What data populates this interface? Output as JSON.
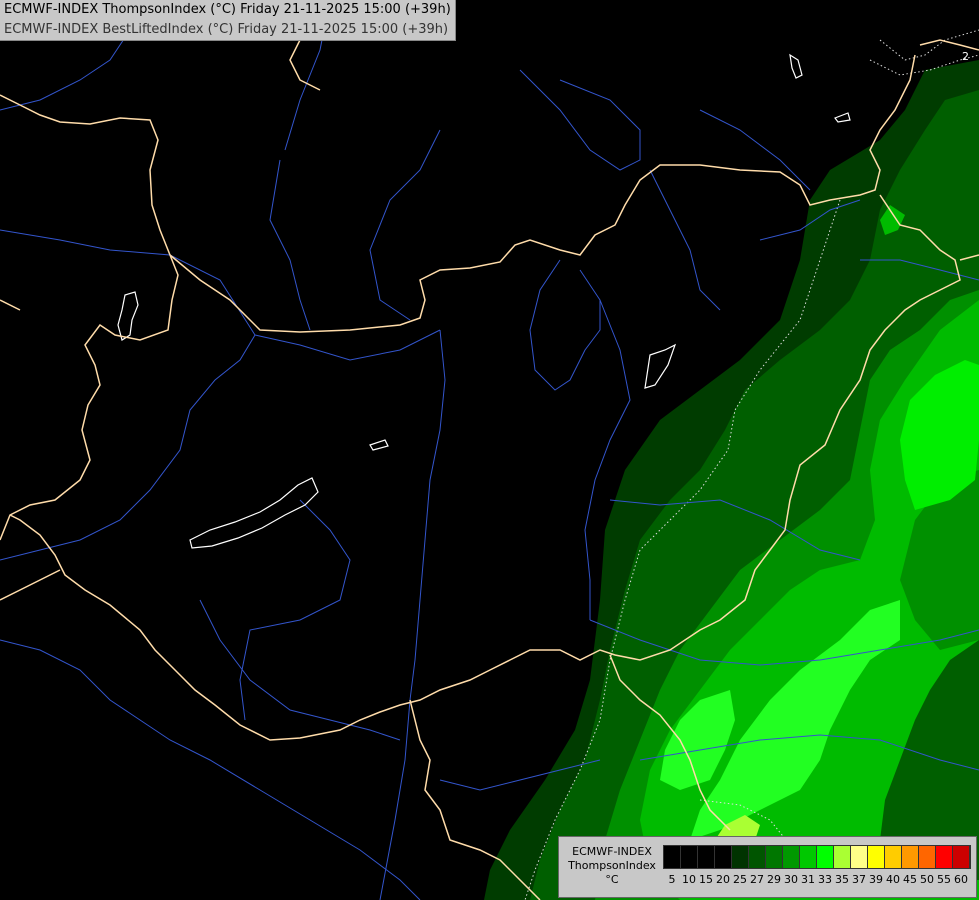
{
  "header": {
    "line1": "ECMWF-INDEX ThompsonIndex (°C) Friday 21-11-2025 15:00 (+39h)",
    "line2": "ECMWF-INDEX BestLiftedIndex (°C) Friday 21-11-2025 15:00 (+39h)"
  },
  "legend": {
    "label_line1": "ECMWF-INDEX",
    "label_line2": "ThompsonIndex",
    "unit": "°C",
    "swatch_colors": [
      "#000000",
      "#000000",
      "#000000",
      "#000000",
      "#003300",
      "#005500",
      "#007700",
      "#009900",
      "#00c800",
      "#00ff00",
      "#aaff33",
      "#ffff88",
      "#ffff00",
      "#ffcc00",
      "#ff9900",
      "#ff6600",
      "#ff0000",
      "#cc0000",
      "#ff00ff",
      "#cc00ff",
      "#9900ff",
      "#6600ff",
      "#3300ff",
      "#0000ff"
    ],
    "tick_labels": [
      "5",
      "10",
      "15",
      "20",
      "25",
      "27",
      "29",
      "30",
      "31",
      "33",
      "35",
      "37",
      "39",
      "40",
      "45",
      "50",
      "55",
      "60"
    ]
  },
  "map": {
    "border_color": "#ffdcaa",
    "river_color": "#3355cc",
    "lake_color": "#ffffff"
  },
  "corner_label": "2"
}
